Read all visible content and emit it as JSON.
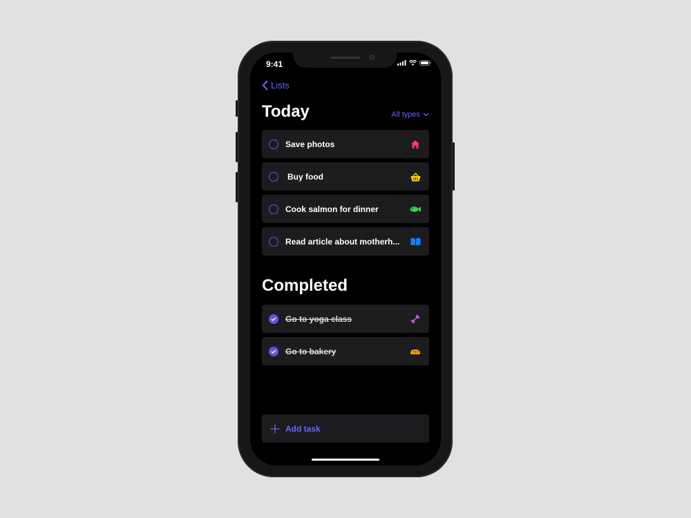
{
  "status_bar": {
    "time": "9:41"
  },
  "nav": {
    "back_label": "Lists"
  },
  "today": {
    "title": "Today",
    "filter_label": "All types",
    "tasks": [
      {
        "label": "Save photos",
        "icon": "home-icon",
        "color": "#ff375f"
      },
      {
        "label": "Buy food",
        "icon": "basket-icon",
        "color": "#ffd60a"
      },
      {
        "label": "Cook salmon for dinner",
        "icon": "fish-icon",
        "color": "#30d158"
      },
      {
        "label": "Read article about motherh...",
        "icon": "book-icon",
        "color": "#0a84ff"
      }
    ]
  },
  "completed": {
    "title": "Completed",
    "tasks": [
      {
        "label": "Go to yoga class",
        "icon": "dumbbell-icon",
        "color": "#bf5af2"
      },
      {
        "label": "Go to bakery",
        "icon": "bread-icon",
        "color": "#ff9f0a"
      }
    ]
  },
  "add_task": {
    "label": "Add task"
  },
  "colors": {
    "accent": "#6b63ff",
    "card": "#1c1c1e",
    "background": "#000000"
  }
}
